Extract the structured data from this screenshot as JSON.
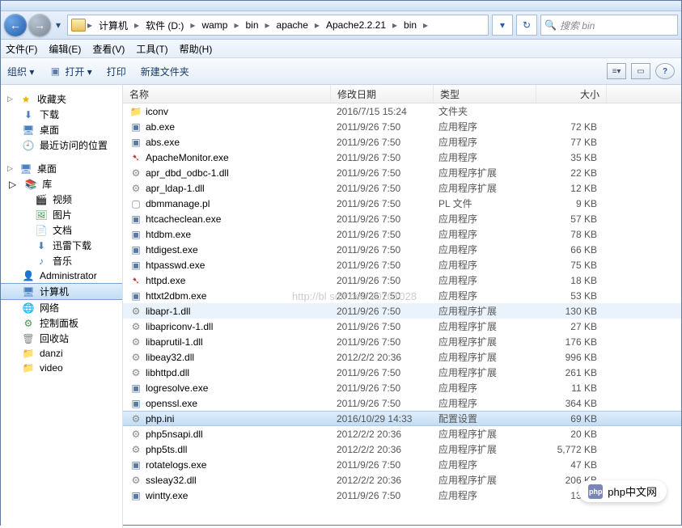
{
  "breadcrumbs": [
    "计算机",
    "软件 (D:)",
    "wamp",
    "bin",
    "apache",
    "Apache2.2.21",
    "bin"
  ],
  "search_placeholder": "搜索 bin",
  "menu": {
    "file": "文件(F)",
    "edit": "编辑(E)",
    "view": "查看(V)",
    "tools": "工具(T)",
    "help": "帮助(H)"
  },
  "toolbar": {
    "organize": "组织 ▾",
    "open": "打开 ▾",
    "print": "打印",
    "new_folder": "新建文件夹"
  },
  "columns": {
    "name": "名称",
    "date": "修改日期",
    "type": "类型",
    "size": "大小"
  },
  "sidebar": {
    "favorites": {
      "label": "收藏夹",
      "items": [
        {
          "label": "下载",
          "icon": "download"
        },
        {
          "label": "桌面",
          "icon": "desktop"
        },
        {
          "label": "最近访问的位置",
          "icon": "recent"
        }
      ]
    },
    "desktop": {
      "label": "桌面",
      "items": [
        {
          "label": "库",
          "icon": "library",
          "children": [
            {
              "label": "视频",
              "icon": "video"
            },
            {
              "label": "图片",
              "icon": "picture"
            },
            {
              "label": "文档",
              "icon": "document"
            },
            {
              "label": "迅雷下载",
              "icon": "thunder"
            },
            {
              "label": "音乐",
              "icon": "music"
            }
          ]
        },
        {
          "label": "Administrator",
          "icon": "user"
        },
        {
          "label": "计算机",
          "icon": "computer",
          "selected": true
        },
        {
          "label": "网络",
          "icon": "network"
        },
        {
          "label": "控制面板",
          "icon": "control"
        },
        {
          "label": "回收站",
          "icon": "recycle"
        },
        {
          "label": "danzi",
          "icon": "folder"
        },
        {
          "label": "video",
          "icon": "folder"
        }
      ]
    }
  },
  "files": [
    {
      "name": "iconv",
      "date": "2016/7/15 15:24",
      "type": "文件夹",
      "size": "",
      "icon": "folder"
    },
    {
      "name": "ab.exe",
      "date": "2011/9/26 7:50",
      "type": "应用程序",
      "size": "72 KB",
      "icon": "exe"
    },
    {
      "name": "abs.exe",
      "date": "2011/9/26 7:50",
      "type": "应用程序",
      "size": "77 KB",
      "icon": "exe"
    },
    {
      "name": "ApacheMonitor.exe",
      "date": "2011/9/26 7:50",
      "type": "应用程序",
      "size": "35 KB",
      "icon": "feather"
    },
    {
      "name": "apr_dbd_odbc-1.dll",
      "date": "2011/9/26 7:50",
      "type": "应用程序扩展",
      "size": "22 KB",
      "icon": "dll"
    },
    {
      "name": "apr_ldap-1.dll",
      "date": "2011/9/26 7:50",
      "type": "应用程序扩展",
      "size": "12 KB",
      "icon": "dll"
    },
    {
      "name": "dbmmanage.pl",
      "date": "2011/9/26 7:50",
      "type": "PL 文件",
      "size": "9 KB",
      "icon": "file"
    },
    {
      "name": "htcacheclean.exe",
      "date": "2011/9/26 7:50",
      "type": "应用程序",
      "size": "57 KB",
      "icon": "exe"
    },
    {
      "name": "htdbm.exe",
      "date": "2011/9/26 7:50",
      "type": "应用程序",
      "size": "78 KB",
      "icon": "exe"
    },
    {
      "name": "htdigest.exe",
      "date": "2011/9/26 7:50",
      "type": "应用程序",
      "size": "66 KB",
      "icon": "exe"
    },
    {
      "name": "htpasswd.exe",
      "date": "2011/9/26 7:50",
      "type": "应用程序",
      "size": "75 KB",
      "icon": "exe"
    },
    {
      "name": "httpd.exe",
      "date": "2011/9/26 7:50",
      "type": "应用程序",
      "size": "18 KB",
      "icon": "feather"
    },
    {
      "name": "httxt2dbm.exe",
      "date": "2011/9/26 7:50",
      "type": "应用程序",
      "size": "53 KB",
      "icon": "exe"
    },
    {
      "name": "libapr-1.dll",
      "date": "2011/9/26 7:50",
      "type": "应用程序扩展",
      "size": "130 KB",
      "icon": "dll",
      "hover": true
    },
    {
      "name": "libapriconv-1.dll",
      "date": "2011/9/26 7:50",
      "type": "应用程序扩展",
      "size": "27 KB",
      "icon": "dll"
    },
    {
      "name": "libaprutil-1.dll",
      "date": "2011/9/26 7:50",
      "type": "应用程序扩展",
      "size": "176 KB",
      "icon": "dll"
    },
    {
      "name": "libeay32.dll",
      "date": "2012/2/2 20:36",
      "type": "应用程序扩展",
      "size": "996 KB",
      "icon": "dll"
    },
    {
      "name": "libhttpd.dll",
      "date": "2011/9/26 7:50",
      "type": "应用程序扩展",
      "size": "261 KB",
      "icon": "dll"
    },
    {
      "name": "logresolve.exe",
      "date": "2011/9/26 7:50",
      "type": "应用程序",
      "size": "11 KB",
      "icon": "exe"
    },
    {
      "name": "openssl.exe",
      "date": "2011/9/26 7:50",
      "type": "应用程序",
      "size": "364 KB",
      "icon": "exe"
    },
    {
      "name": "php.ini",
      "date": "2016/10/29 14:33",
      "type": "配置设置",
      "size": "69 KB",
      "icon": "ini",
      "selected": true
    },
    {
      "name": "php5nsapi.dll",
      "date": "2012/2/2 20:36",
      "type": "应用程序扩展",
      "size": "20 KB",
      "icon": "dll"
    },
    {
      "name": "php5ts.dll",
      "date": "2012/2/2 20:36",
      "type": "应用程序扩展",
      "size": "5,772 KB",
      "icon": "dll"
    },
    {
      "name": "rotatelogs.exe",
      "date": "2011/9/26 7:50",
      "type": "应用程序",
      "size": "47 KB",
      "icon": "exe"
    },
    {
      "name": "ssleay32.dll",
      "date": "2012/2/2 20:36",
      "type": "应用程序扩展",
      "size": "206 KB",
      "icon": "dll"
    },
    {
      "name": "wintty.exe",
      "date": "2011/9/26 7:50",
      "type": "应用程序",
      "size": "13 KB",
      "icon": "exe"
    }
  ],
  "watermark": "http://bl      sdn net/     20201028",
  "badge": "php中文网"
}
